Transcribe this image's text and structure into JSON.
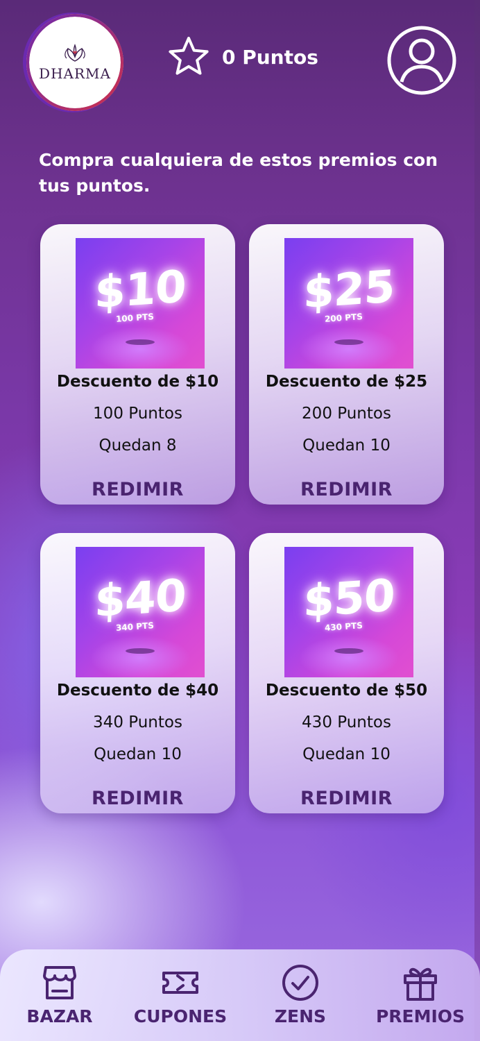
{
  "header": {
    "logo_text": "DHARMA",
    "points_label": "0 Puntos"
  },
  "intro": "Compra cualquiera de estos premios con tus puntos.",
  "rewards": [
    {
      "image_amount": "$10",
      "image_pts": "100 PTS",
      "title": "Descuento de $10",
      "points": "100 Puntos",
      "stock": "Quedan 8",
      "button": "REDIMIR"
    },
    {
      "image_amount": "$25",
      "image_pts": "200 PTS",
      "title": "Descuento de $25",
      "points": "200 Puntos",
      "stock": "Quedan 10",
      "button": "REDIMIR"
    },
    {
      "image_amount": "$40",
      "image_pts": "340 PTS",
      "title": "Descuento de $40",
      "points": "340 Puntos",
      "stock": "Quedan 10",
      "button": "REDIMIR"
    },
    {
      "image_amount": "$50",
      "image_pts": "430 PTS",
      "title": "Descuento de $50",
      "points": "430 Puntos",
      "stock": "Quedan 10",
      "button": "REDIMIR"
    }
  ],
  "nav": [
    {
      "label": "BAZAR",
      "icon": "store-icon"
    },
    {
      "label": "CUPONES",
      "icon": "ticket-icon"
    },
    {
      "label": "ZENS",
      "icon": "check-circle-icon"
    },
    {
      "label": "PREMIOS",
      "icon": "gift-icon"
    }
  ],
  "colors": {
    "accent_text": "#4a2470",
    "background_top": "#5a2a78",
    "background_bottom": "#9a6be0"
  }
}
